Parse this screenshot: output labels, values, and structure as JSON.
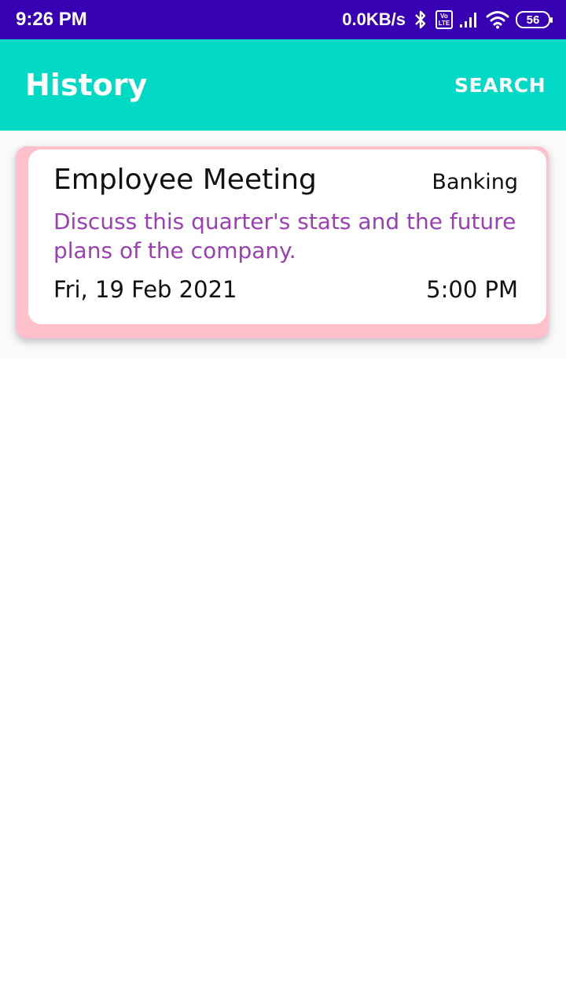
{
  "status_bar": {
    "time": "9:26 PM",
    "net_speed": "0.0KB/s",
    "volte_top": "Vo",
    "volte_bottom": "LTE",
    "battery": "56"
  },
  "app_bar": {
    "title": "History",
    "search_label": "SEARCH"
  },
  "history": [
    {
      "title": "Employee Meeting",
      "category": "Banking",
      "description": "Discuss this quarter's stats and the future plans of the company.",
      "date": "Fri, 19 Feb 2021",
      "time": "5:00 PM"
    }
  ],
  "colors": {
    "status_bar": "#3800b3",
    "app_bar": "#03dac5",
    "card_border": "#ffc0cb",
    "description_text": "#9b3fb5"
  }
}
